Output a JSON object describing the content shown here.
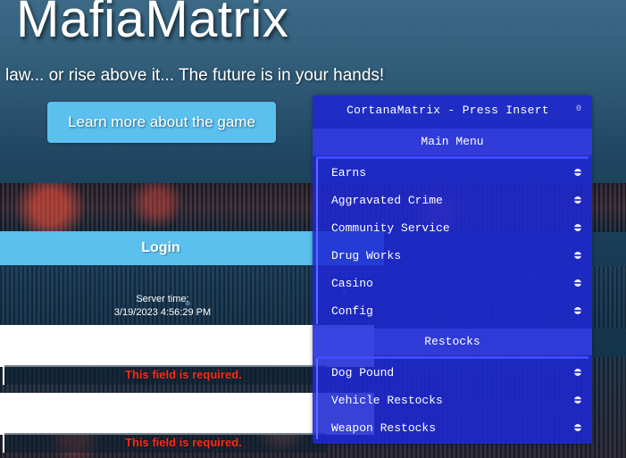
{
  "site": {
    "brand": "MafiaMatrix",
    "tagline": "law... or rise above it... The future is in your hands!",
    "learn_more_label": "Learn more about the game"
  },
  "login": {
    "title": "Login",
    "server_time_label": "Server time:",
    "server_time_value": "3/19/2023 4:56:29 PM",
    "field_error_1": "This field is required.",
    "field_error_2": "This field is required."
  },
  "overlay": {
    "title": "CortanaMatrix - Press Insert",
    "title_glyph": "0",
    "main_menu_label": "Main Menu",
    "main_items": [
      {
        "label": "Earns"
      },
      {
        "label": "Aggravated Crime"
      },
      {
        "label": "Community Service"
      },
      {
        "label": "Drug Works"
      },
      {
        "label": "Casino"
      },
      {
        "label": "Config"
      }
    ],
    "restocks_label": "Restocks",
    "restock_items": [
      {
        "label": "Dog Pound"
      },
      {
        "label": "Vehicle Restocks"
      },
      {
        "label": "Weapon Restocks"
      }
    ],
    "accent_color": "#1f28d2",
    "item_indicator": "toggle-indicator-icon"
  },
  "colors": {
    "primary_button": "#5bc0ee",
    "error_text": "#ff2a1a"
  }
}
